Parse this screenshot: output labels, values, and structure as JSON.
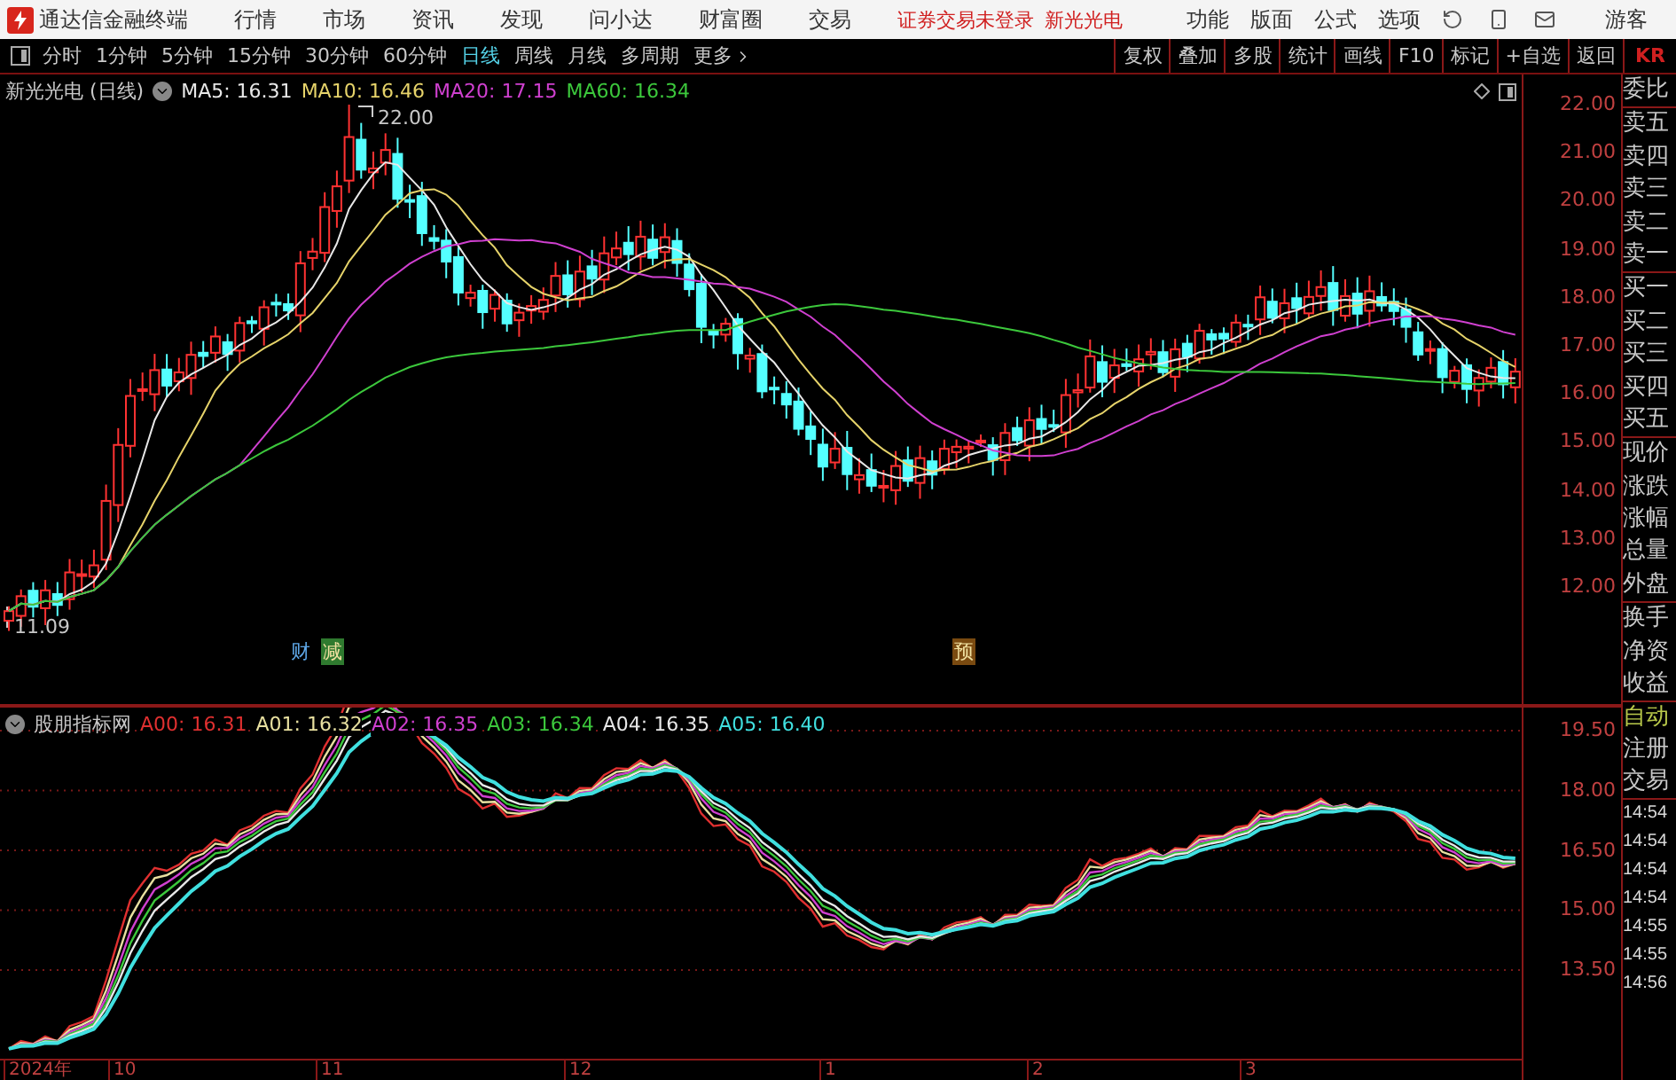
{
  "app": {
    "title": "通达信金融终端"
  },
  "menu": [
    "行情",
    "市场",
    "资讯",
    "发现",
    "问小达",
    "财富圈",
    "交易"
  ],
  "login_status": "证券交易未登录",
  "stock_link": "新光光电",
  "menu_right": [
    "功能",
    "版面",
    "公式",
    "选项"
  ],
  "user": "游客",
  "periods": [
    {
      "label": "分时",
      "selected": false
    },
    {
      "label": "1分钟",
      "selected": false
    },
    {
      "label": "5分钟",
      "selected": false
    },
    {
      "label": "15分钟",
      "selected": false
    },
    {
      "label": "30分钟",
      "selected": false
    },
    {
      "label": "60分钟",
      "selected": false
    },
    {
      "label": "日线",
      "selected": true
    },
    {
      "label": "周线",
      "selected": false
    },
    {
      "label": "月线",
      "selected": false
    },
    {
      "label": "多周期",
      "selected": false
    }
  ],
  "more": "更多",
  "tools": [
    "复权",
    "叠加",
    "多股",
    "统计",
    "画线",
    "F10",
    "标记",
    "+自选",
    "返回"
  ],
  "quote_panel": {
    "header": "KR",
    "groups": [
      [
        "委比"
      ],
      [
        "卖五",
        "卖四",
        "卖三",
        "卖二",
        "卖一"
      ],
      [
        "买一",
        "买二",
        "买三",
        "买四",
        "买五"
      ],
      [
        "现价",
        "涨跌",
        "涨幅",
        "总量",
        "外盘"
      ],
      [
        "换手",
        "净资",
        "收益"
      ]
    ],
    "mode": "自动",
    "links": [
      "注册",
      "交易"
    ],
    "times": [
      "14:54",
      "14:54",
      "14:54",
      "14:54",
      "14:55",
      "14:55",
      "14:56"
    ]
  },
  "main_chart": {
    "title": "新光光电 (日线)",
    "ma": [
      {
        "label": "MA5: 16.31",
        "color": "#e8e8e8"
      },
      {
        "label": "MA10: 16.46",
        "color": "#e6d36a"
      },
      {
        "label": "MA20: 17.15",
        "color": "#d040d0"
      },
      {
        "label": "MA60: 16.34",
        "color": "#3cc83c"
      }
    ],
    "high_label": "22.00",
    "low_label": "11.09",
    "events": [
      {
        "label": "财",
        "kind": "text",
        "color": "#5fa8e8"
      },
      {
        "label": "减",
        "kind": "tag",
        "color": "#2f7a2f"
      },
      {
        "label": "预",
        "kind": "tag",
        "color": "#7a4a10"
      }
    ],
    "axis": [
      "22.00",
      "21.00",
      "20.00",
      "19.00",
      "18.00",
      "17.00",
      "16.00",
      "15.00",
      "14.00",
      "13.00",
      "12.00"
    ]
  },
  "indicator": {
    "title": "股朋指标网",
    "lines": [
      {
        "label": "A00: 16.31",
        "color": "#e03030"
      },
      {
        "label": "A01: 16.32",
        "color": "#e8e0a0"
      },
      {
        "label": "A02: 16.35",
        "color": "#d040d0"
      },
      {
        "label": "A03: 16.34",
        "color": "#3cc83c"
      },
      {
        "label": "A04: 16.35",
        "color": "#e8e8e8"
      },
      {
        "label": "A05: 16.40",
        "color": "#40e0e0"
      }
    ],
    "axis": [
      "19.50",
      "18.00",
      "16.50",
      "15.00",
      "13.50"
    ]
  },
  "date_axis": [
    "2024年",
    "10",
    "11",
    "12",
    "1",
    "2",
    "3"
  ]
}
